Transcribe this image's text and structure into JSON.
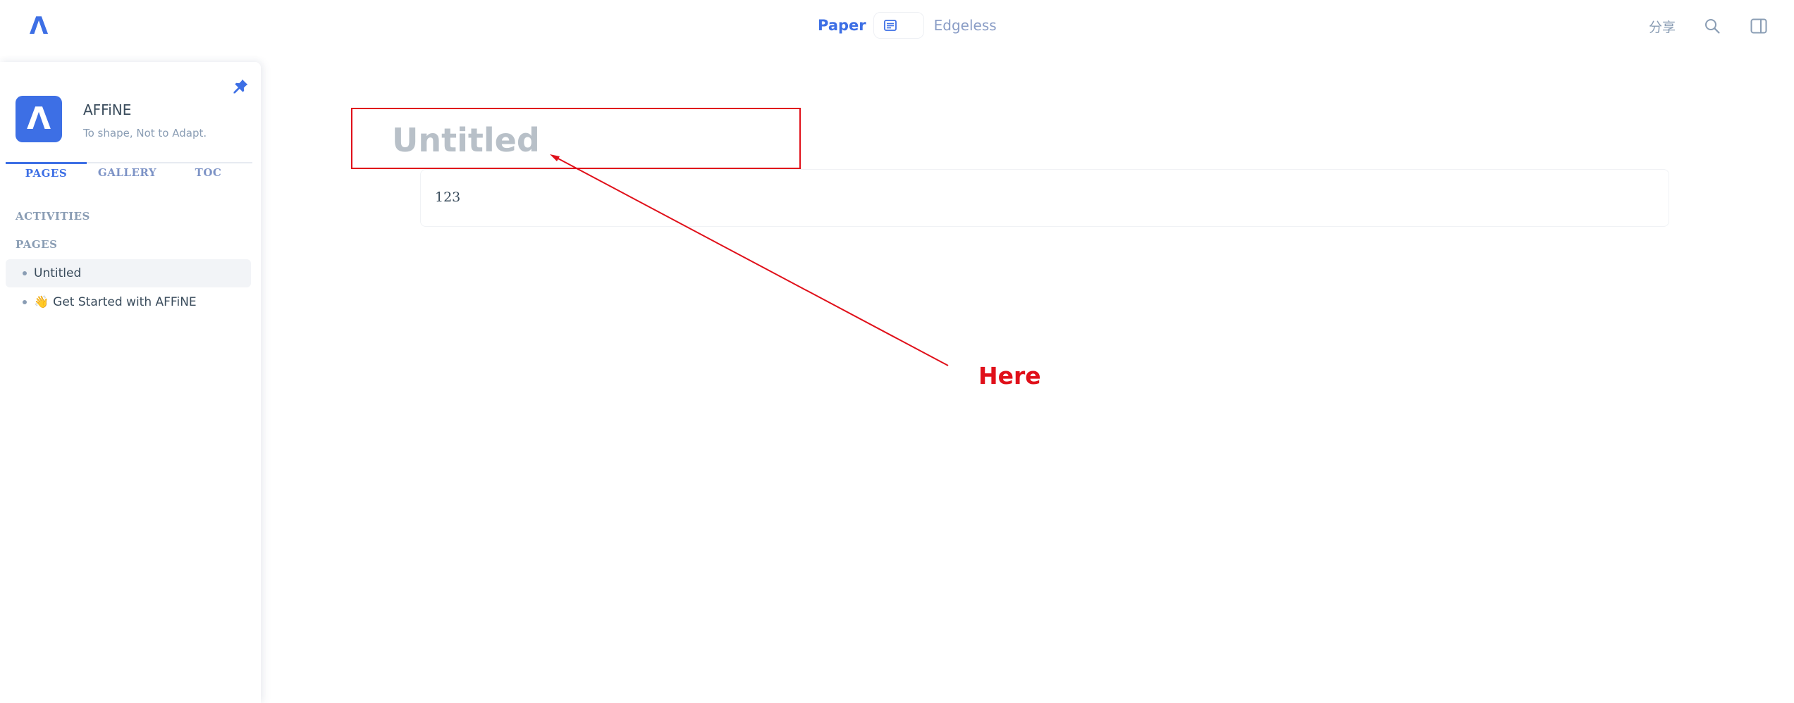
{
  "topbar": {
    "logo": "Λ",
    "mode_paper": "Paper",
    "mode_edgeless": "Edgeless",
    "share": "分享",
    "icons": [
      "paper-mode-icon",
      "search-icon",
      "sidebar-toggle-icon"
    ]
  },
  "sidebar": {
    "workspace_avatar": "Λ",
    "workspace_name": "AFFiNE",
    "workspace_slogan": "To shape, Not to Adapt.",
    "tabs": [
      {
        "label": "PAGES",
        "active": true
      },
      {
        "label": "GALLERY",
        "active": false
      },
      {
        "label": "TOC",
        "active": false
      }
    ],
    "activities_label": "ACTIVITIES",
    "pages_label": "PAGES",
    "pages": [
      {
        "title": "Untitled",
        "emoji": ""
      },
      {
        "title": "Get Started with AFFiNE",
        "emoji": "👋"
      }
    ]
  },
  "editor": {
    "title_placeholder": "Untitled",
    "block_text": "123"
  },
  "annotation": {
    "label": "Here",
    "color": "#e0101a"
  },
  "colors": {
    "accent": "#3d6fe5",
    "muted": "#8a9db4",
    "text": "#3a4c5c"
  }
}
